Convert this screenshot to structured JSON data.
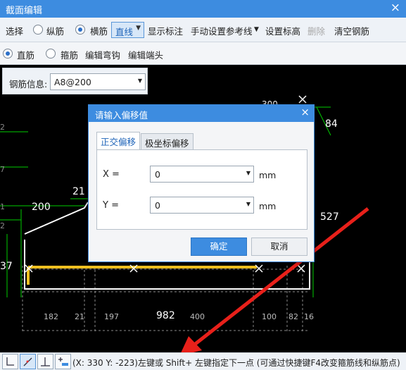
{
  "window": {
    "title": "截面编辑",
    "close": "×"
  },
  "toolbar1": {
    "select": "选择",
    "longitudinal": "纵筋",
    "stirrup": "横筋",
    "line_mode": "直线",
    "show_dims": "显示标注",
    "manual_ref": "手动设置参考线",
    "set_elev": "设置标高",
    "delete": "删除",
    "clear": "清空钢筋"
  },
  "toolbar2": {
    "straight": "直筋",
    "hoop": "箍筋",
    "edit_hook": "编辑弯钩",
    "edit_end": "编辑端头"
  },
  "rebar_info": {
    "label": "钢筋信息:",
    "value": "A8@200"
  },
  "drawing": {
    "dims": [
      "84",
      "527",
      "200",
      "21",
      "982",
      "182",
      "21",
      "197",
      "400",
      "100",
      "82",
      "16",
      "300"
    ],
    "left_marks": [
      "2",
      "7",
      "1",
      "2",
      "37"
    ]
  },
  "dialog": {
    "title": "请输入偏移值",
    "close": "×",
    "tabs": [
      "正交偏移",
      "极坐标偏移"
    ],
    "x_label": "X =",
    "x_value": "0",
    "y_label": "Y =",
    "y_value": "0",
    "unit": "mm",
    "ok": "确定",
    "cancel": "取消"
  },
  "status": {
    "message": "(X: 330 Y: -223)左键或 Shift+ 左键指定下一点 (可通过快捷键F4改变箍筋线和纵筋点)"
  },
  "colors": {
    "accent": "#3d8ce0",
    "rebar": "#f0c020",
    "dim_green": "#00cc00",
    "arrow": "#e8201a"
  }
}
